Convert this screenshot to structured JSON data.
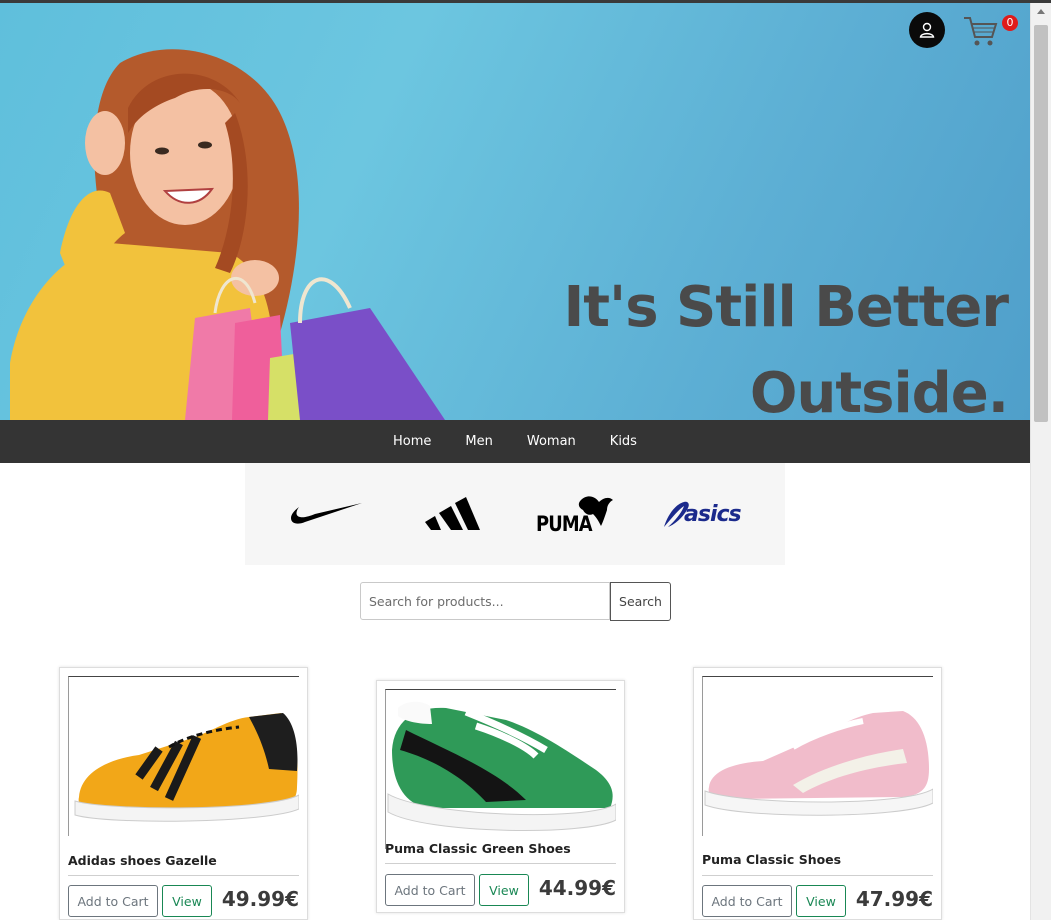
{
  "hero": {
    "title_line1": "It's Still Better",
    "title_line2": "Outside.",
    "cart_count": "0",
    "icons": [
      "user-icon",
      "cart-icon"
    ]
  },
  "nav": {
    "items": [
      "Home",
      "Men",
      "Woman",
      "Kids"
    ]
  },
  "brands": [
    "nike",
    "adidas",
    "puma",
    "asics"
  ],
  "brand_logo_text": {
    "puma": "PUMA",
    "asics": "asics"
  },
  "search": {
    "placeholder": "Search for products...",
    "button": "Search"
  },
  "products": [
    {
      "name": "Adidas shoes Gazelle",
      "price": "49.99€",
      "add_to_cart": "Add to Cart",
      "view": "View",
      "color": "#f2a718"
    },
    {
      "name": "Puma Classic Green Shoes",
      "price": "44.99€",
      "add_to_cart": "Add to Cart",
      "view": "View",
      "color": "#2f9a58"
    },
    {
      "name": "Puma Classic Shoes",
      "price": "47.99€",
      "add_to_cart": "Add to Cart",
      "view": "View",
      "color": "#f1bccb"
    }
  ],
  "colors": {
    "nav_bg": "#343434",
    "hero_bg": "#6cc6e0",
    "badge": "#e01b1b"
  }
}
